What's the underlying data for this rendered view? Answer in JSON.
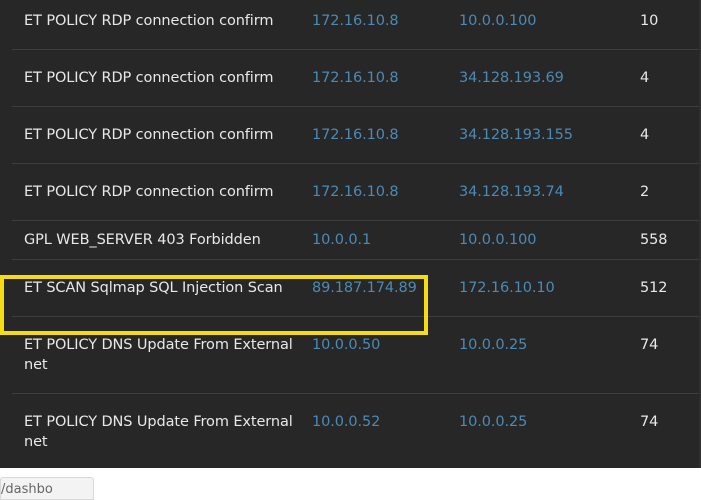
{
  "alerts": {
    "rows": [
      {
        "signature": "ET POLICY RDP connection confirm",
        "src": "172.16.10.8",
        "dst": "10.0.0.100",
        "count": "10"
      },
      {
        "signature": "ET POLICY RDP connection confirm",
        "src": "172.16.10.8",
        "dst": "34.128.193.69",
        "count": "4"
      },
      {
        "signature": "ET POLICY RDP connection confirm",
        "src": "172.16.10.8",
        "dst": "34.128.193.155",
        "count": "4"
      },
      {
        "signature": "ET POLICY RDP connection confirm",
        "src": "172.16.10.8",
        "dst": "34.128.193.74",
        "count": "2"
      },
      {
        "signature": "GPL WEB_SERVER 403 Forbidden",
        "src": "10.0.0.1",
        "dst": "10.0.0.100",
        "count": "558"
      },
      {
        "signature": "ET SCAN Sqlmap SQL Injection Scan",
        "src": "89.187.174.89",
        "dst": "172.16.10.10",
        "count": "512"
      },
      {
        "signature": "ET POLICY DNS Update From External net",
        "src": "10.0.0.50",
        "dst": "10.0.0.25",
        "count": "74"
      },
      {
        "signature": "ET POLICY DNS Update From External net",
        "src": "10.0.0.52",
        "dst": "10.0.0.25",
        "count": "74"
      }
    ]
  },
  "url_fragment": "/dashbo",
  "colors": {
    "panel_bg": "#272727",
    "text": "#e8e8e8",
    "link": "#4b8ab5",
    "highlight": "#f5dc13"
  }
}
